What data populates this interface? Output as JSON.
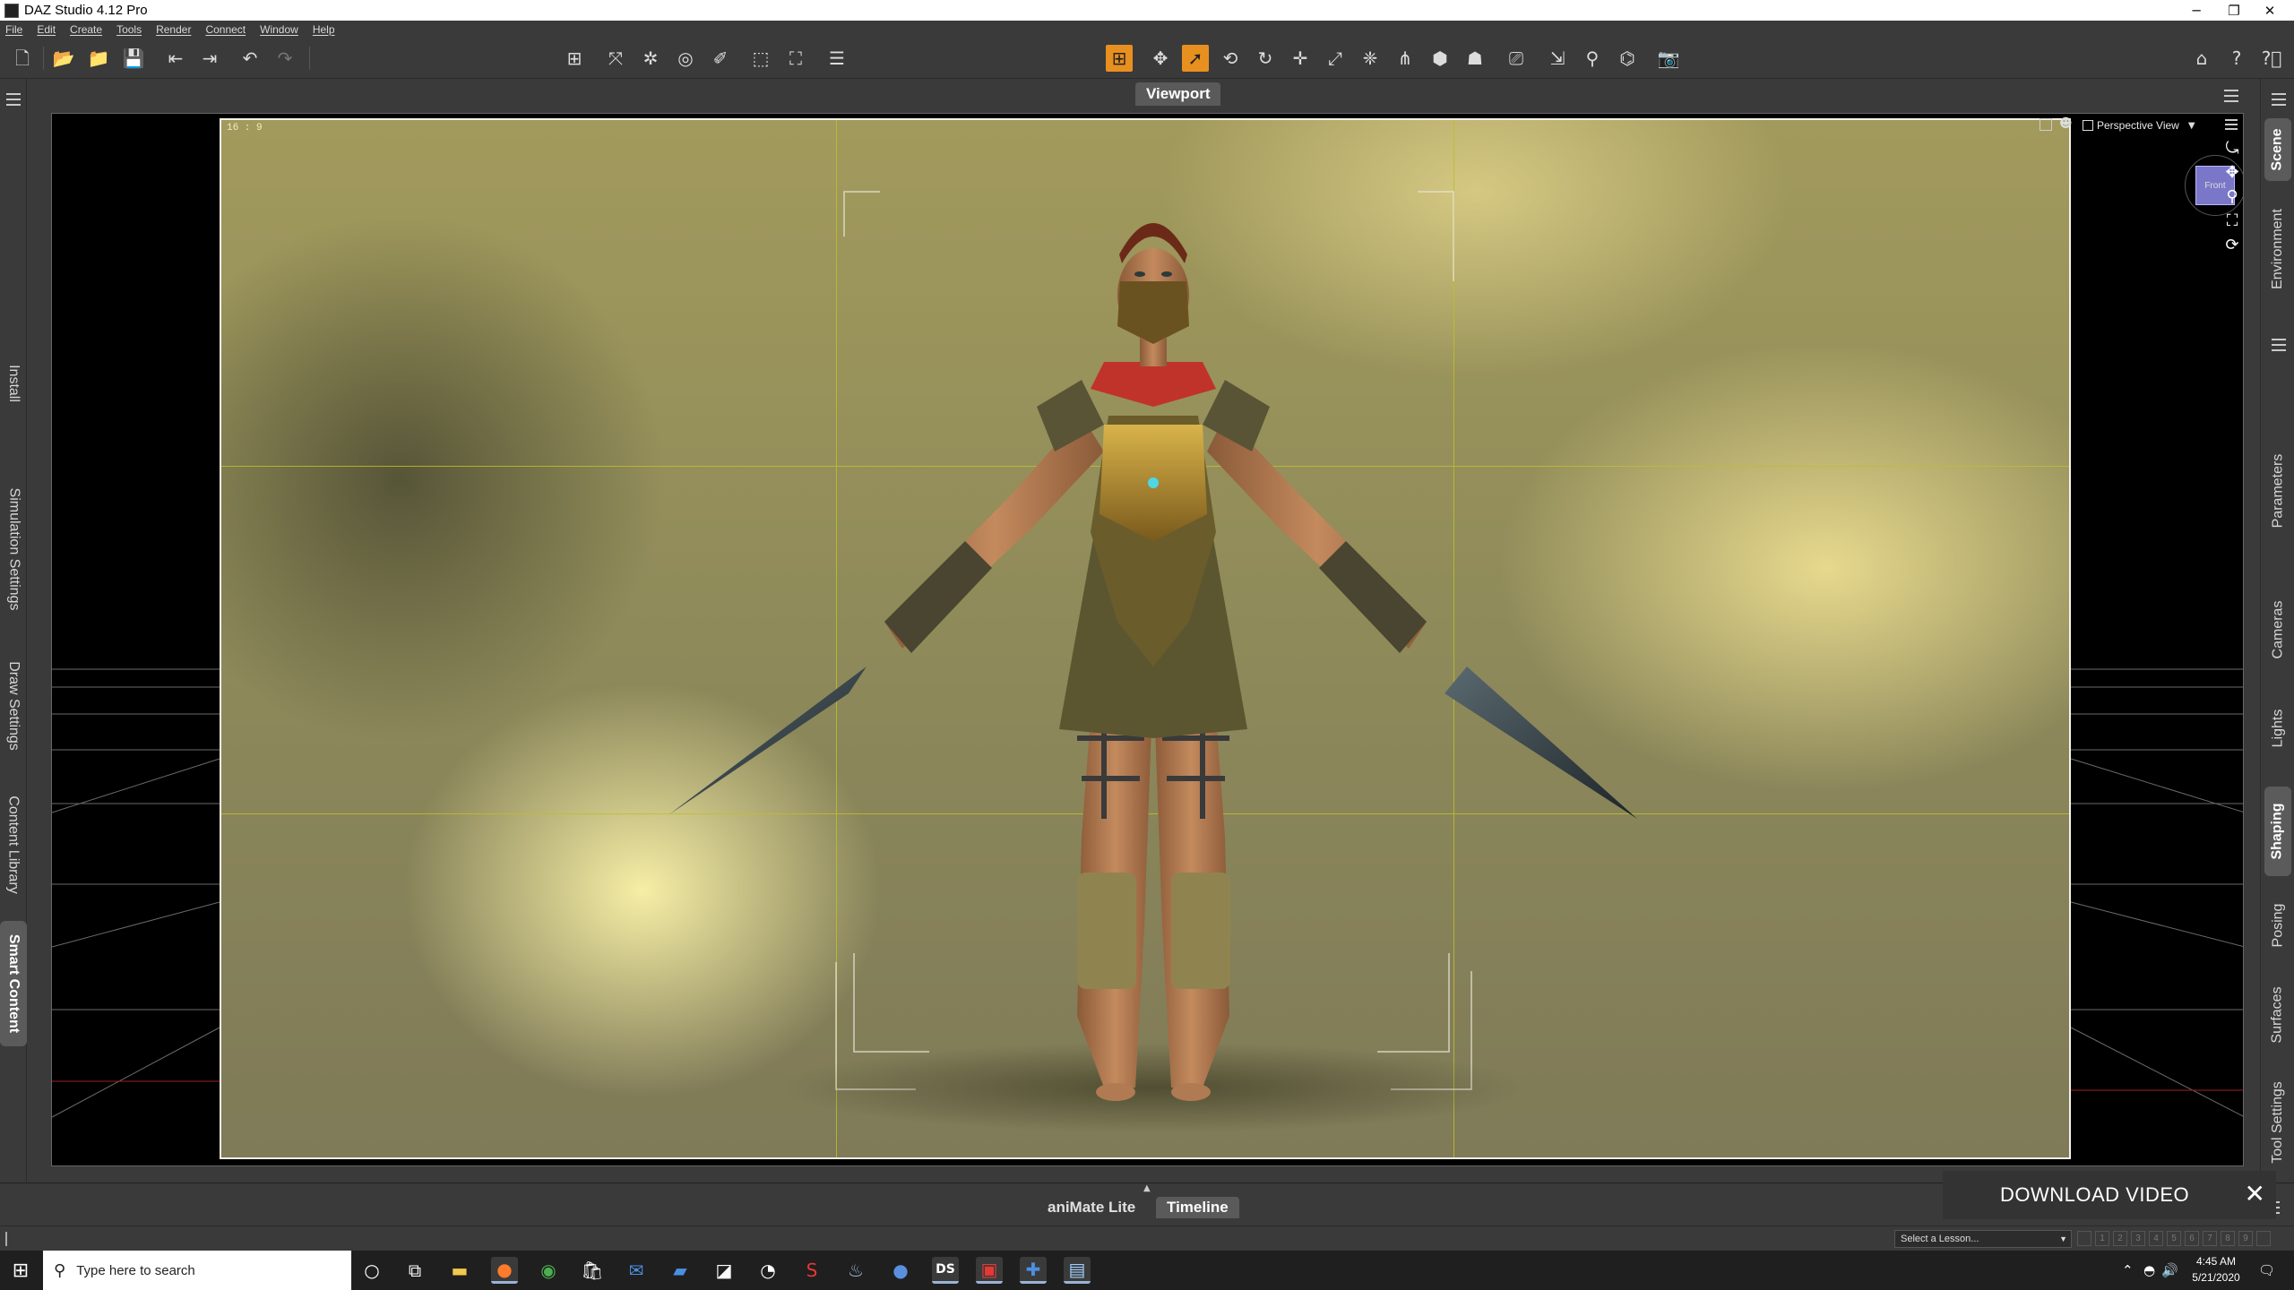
{
  "window": {
    "title": "DAZ Studio 4.12 Pro",
    "controls": {
      "minimize": "─",
      "maximize": "❐",
      "close": "✕"
    }
  },
  "menu": [
    "File",
    "Edit",
    "Create",
    "Tools",
    "Render",
    "Connect",
    "Window",
    "Help"
  ],
  "toolbar": {
    "left_icons": [
      "new-icon",
      "open-icon",
      "merge-icon",
      "save-icon",
      "import-icon",
      "export-icon",
      "undo-icon",
      "redo-icon"
    ],
    "center_icons": [
      "scene-add-icon",
      "joint-editor-icon",
      "node-weight-icon",
      "geometry-editor-icon",
      "surface-selection-icon",
      "spot-render-icon",
      "region-navigator-icon",
      "list-icon"
    ],
    "main_tools": [
      "active-pose-tool-icon",
      "universal-tool-icon",
      "node-selection-tool-icon",
      "rotate-tool-icon",
      "twist-tool-icon",
      "translate-tool-icon",
      "scale-tool-icon",
      "surface-selection-tool-icon",
      "geometry-editor-tool-icon",
      "joint-editor-tool-icon",
      "node-weight-tool-icon",
      "figure-tool-icon",
      "render-tool-icon",
      "pose-tool-icon",
      "sculpt-tool-icon",
      "morph-tool-icon",
      "camera-tool-icon"
    ],
    "right_icons": [
      "home-icon",
      "whats-this-icon",
      "help-icon"
    ],
    "active_tool": "node-selection-tool-icon"
  },
  "left_tabs": [
    "Install",
    "Simulation Settings",
    "Draw Settings",
    "Content Library",
    "Smart Content"
  ],
  "left_tab_selected": "Smart Content",
  "right_tabs_top": [
    "Scene",
    "Environment"
  ],
  "right_tabs_bottom": [
    "Parameters",
    "Cameras",
    "Lights",
    "Shaping",
    "Posing",
    "Surfaces",
    "Tool Settings"
  ],
  "right_tab_selected_top": "Scene",
  "right_tab_selected_bottom": "Shaping",
  "viewport": {
    "tab_label": "Viewport",
    "aspect_ratio": "16 : 9",
    "view_label": "Perspective View",
    "cube_label": "Front",
    "nav_icons": [
      "orbit-icon",
      "pan-icon",
      "zoom-icon",
      "frame-icon",
      "reset-icon"
    ]
  },
  "bottom": {
    "tabs": [
      "aniMate Lite",
      "Timeline"
    ],
    "selected_tab": "Timeline",
    "download_label": "DOWNLOAD VIDEO",
    "download_close": "✕",
    "lesson_placeholder": "Select a Lesson...",
    "steps": [
      "1",
      "2",
      "3",
      "4",
      "5",
      "6",
      "7",
      "8",
      "9"
    ]
  },
  "taskbar": {
    "search_placeholder": "Type here to search",
    "time": "4:45 AM",
    "date": "5/21/2020",
    "apps": [
      "cortana-icon",
      "task-view-icon",
      "file-explorer-icon",
      "firefox-icon",
      "chrome-icon",
      "store-icon",
      "mail-icon",
      "paint-icon",
      "steam-tool-icon",
      "mcafee-icon",
      "steam-icon",
      "gb-icon",
      "daz-studio-icon",
      "snip-icon",
      "tool-icon",
      "notepad-icon"
    ]
  },
  "colors": {
    "accent": "#e8901f",
    "panel_bg": "#3a3a3a",
    "grid": "#bebe28",
    "viewport_bg": "#000000"
  }
}
